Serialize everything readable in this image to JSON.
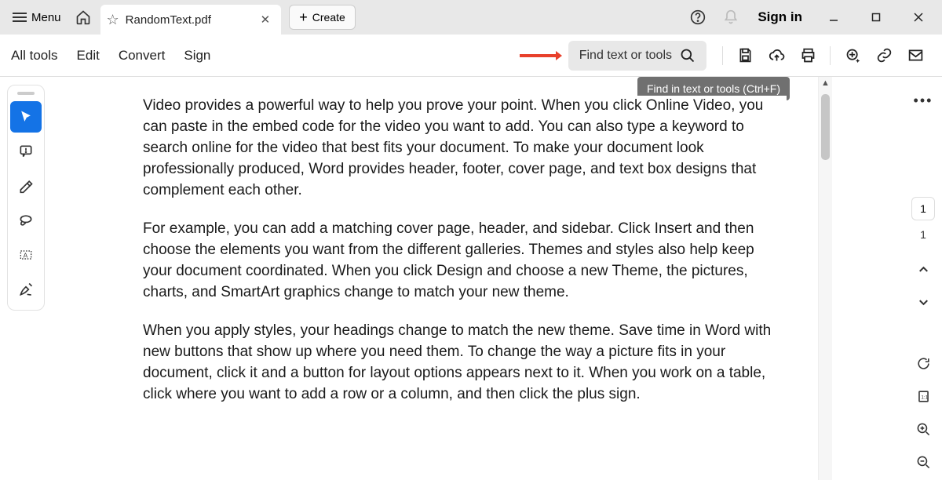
{
  "titlebar": {
    "menu_label": "Menu",
    "tab_title": "RandomText.pdf",
    "create_label": "Create",
    "signin_label": "Sign in"
  },
  "toolbar": {
    "menu": {
      "alltools": "All tools",
      "edit": "Edit",
      "convert": "Convert",
      "sign": "Sign"
    },
    "find_label": "Find text or tools",
    "find_tooltip": "Find in text or tools (Ctrl+F)"
  },
  "document": {
    "paragraphs": [
      "Video provides a powerful way to help you prove your point. When you click Online Video, you can paste in the embed code for the video you want to add. You can also type a keyword to search online for the video that best fits your document. To make your document look professionally produced, Word provides header, footer, cover page, and text box designs that complement each other.",
      "For example, you can add a matching cover page, header, and sidebar. Click Insert and then choose the elements you want from the different galleries. Themes and styles also help keep your document coordinated. When you click Design and choose a new Theme, the pictures, charts, and SmartArt graphics change to match your new theme.",
      "When you apply styles, your headings change to match the new theme. Save time in Word with new buttons that show up where you need them. To change the way a picture fits in your document, click it and a button for layout options appears next to it. When you work on a table, click where you want to add a row or a column, and then click the plus sign."
    ]
  },
  "right_rail": {
    "current_page": "1",
    "page_count": "1"
  }
}
